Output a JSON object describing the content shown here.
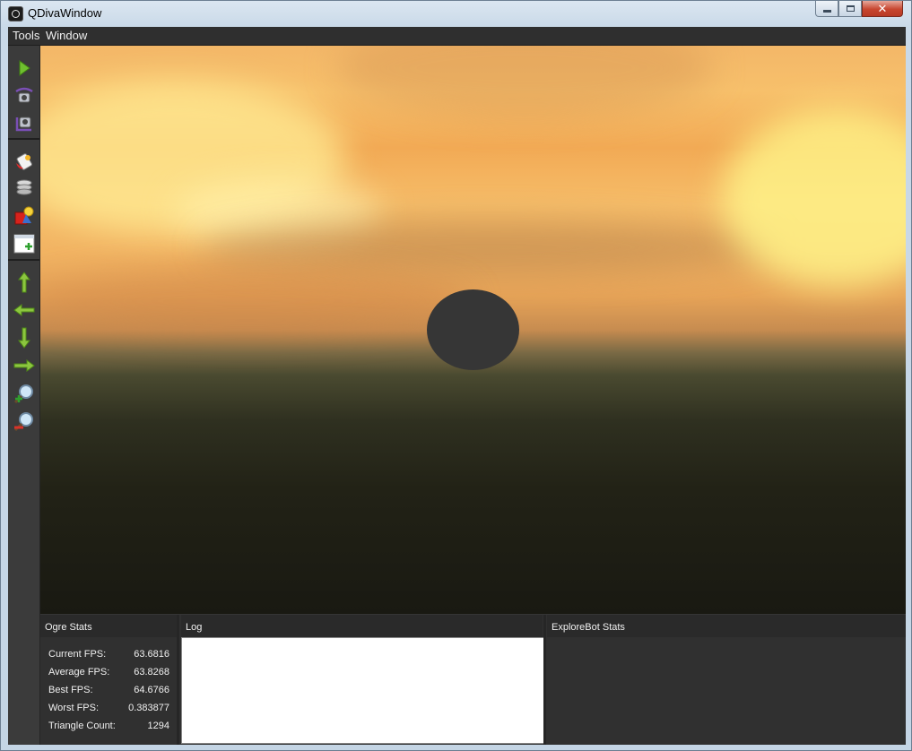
{
  "window": {
    "title": "QDivaWindow",
    "controls": {
      "minimize": "minimize",
      "maximize": "maximize",
      "close": "✕"
    }
  },
  "menu": {
    "items": [
      "Tools",
      "Window"
    ]
  },
  "toolbar": {
    "icons": [
      "play-icon",
      "camera-rotate-icon",
      "camera-reset-icon",
      "paint-bucket-icon",
      "disk-stack-icon",
      "shape-light-icon",
      "add-panel-icon",
      "arrow-up-icon",
      "arrow-left-icon",
      "arrow-down-icon",
      "arrow-right-icon",
      "zoom-in-icon",
      "zoom-out-icon"
    ]
  },
  "panels": {
    "ogre_stats": {
      "title": "Ogre Stats",
      "rows": [
        {
          "label": "Current FPS:",
          "value": "63.6816"
        },
        {
          "label": "Average FPS:",
          "value": "63.8268"
        },
        {
          "label": "Best FPS:",
          "value": "64.6766"
        },
        {
          "label": "Worst FPS:",
          "value": "0.383877"
        },
        {
          "label": "Triangle Count:",
          "value": "1294"
        }
      ]
    },
    "log": {
      "title": "Log"
    },
    "explorebot": {
      "title": "ExploreBot Stats"
    }
  },
  "colors": {
    "accent_green": "#8cc63f",
    "panel_bg": "#303030",
    "close_red": "#c7462f"
  }
}
